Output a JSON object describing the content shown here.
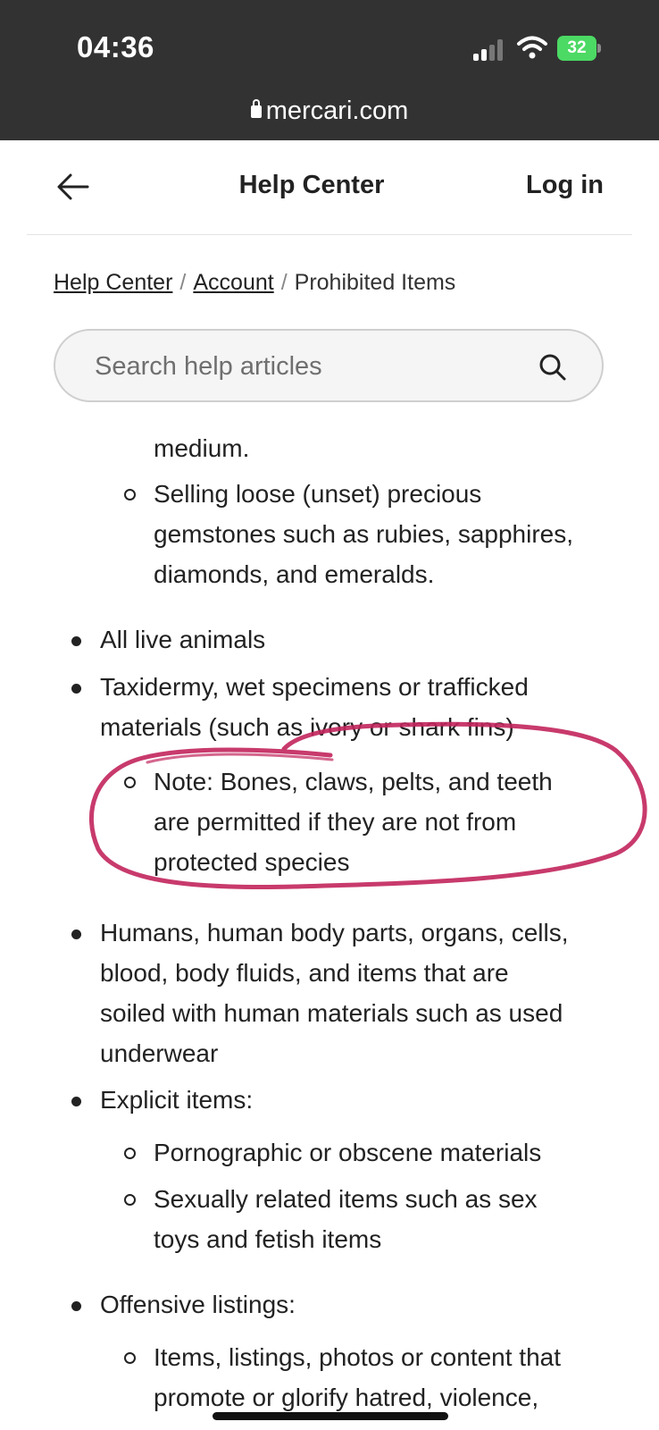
{
  "status_bar": {
    "time": "04:36",
    "battery": "32"
  },
  "url_bar": {
    "domain": "mercari.com"
  },
  "header": {
    "title": "Help Center",
    "login": "Log in"
  },
  "breadcrumb": {
    "items": [
      "Help Center",
      "Account"
    ],
    "current": "Prohibited Items",
    "separator": "/"
  },
  "search": {
    "placeholder": "Search help articles"
  },
  "article": {
    "fragment_line": "medium.",
    "gemstones_lines": [
      "Selling loose (unset) precious",
      "gemstones such as rubies, sapphires,",
      "diamonds, and emeralds."
    ],
    "live_animals": "All live animals",
    "taxidermy_lines": [
      "Taxidermy, wet specimens or trafficked",
      "materials (such as ivory or shark fins)"
    ],
    "note_lines": [
      "Note: Bones, claws, pelts, and teeth",
      "are permitted if they are not from",
      "protected species"
    ],
    "humans_lines": [
      "Humans, human body parts, organs, cells,",
      "blood, body fluids, and items that are",
      "soiled with human materials such as used",
      "underwear"
    ],
    "explicit": "Explicit items:",
    "porn": "Pornographic or obscene materials",
    "sex_lines": [
      "Sexually related items such as sex",
      "toys and fetish items"
    ],
    "offensive": "Offensive listings:",
    "offensive_sub_lines": [
      "Items, listings, photos or content that",
      "promote or glorify hatred, violence,"
    ]
  },
  "colors": {
    "status_bg": "#323232",
    "annotation": "#c2255c",
    "battery": "#4cd964"
  }
}
